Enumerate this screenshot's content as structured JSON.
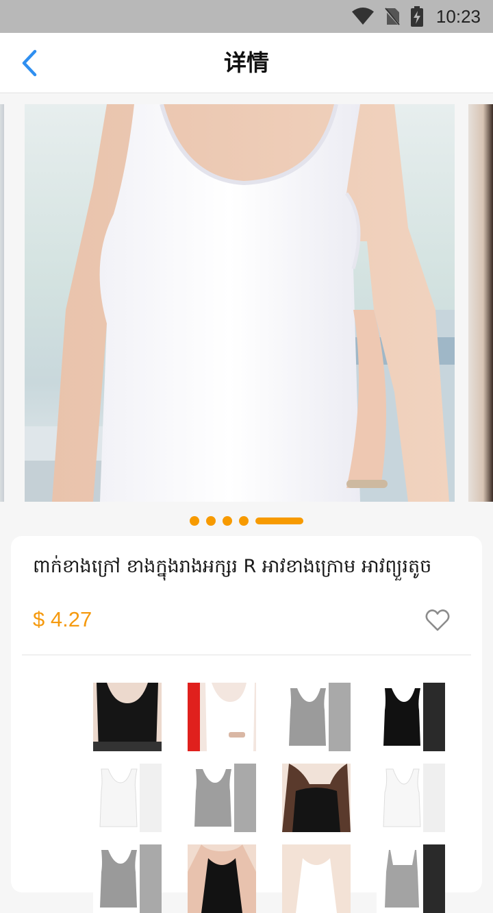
{
  "status_bar": {
    "time": "10:23",
    "icons": [
      "wifi-icon",
      "no-sim-icon",
      "battery-charging-icon"
    ]
  },
  "header": {
    "back_icon": "chevron-left-icon",
    "title": "详情"
  },
  "carousel": {
    "slide_count": 5,
    "active_index": 4
  },
  "product": {
    "title": "ពាក់ខាងក្រៅ ខាងក្នុងរាងអក្សរ R អាវខាងក្រោម អាវព្យួរតូច",
    "price": "$ 4.27",
    "favorite_icon": "heart-outline-icon"
  },
  "colors": {
    "accent": "#f79a00",
    "price": "#f59a0f",
    "back": "#2f8ff0"
  },
  "thumbnails": [
    {
      "name": "black-tank-model"
    },
    {
      "name": "white-tank-model-red-banner"
    },
    {
      "name": "gray-tank-flat"
    },
    {
      "name": "black-tank-flat"
    },
    {
      "name": "white-tank-flat"
    },
    {
      "name": "gray-tank-flat-2"
    },
    {
      "name": "black-tank-back-model"
    },
    {
      "name": "white-racerback-flat"
    },
    {
      "name": "gray-racerback-flat"
    },
    {
      "name": "black-tank-model-2"
    },
    {
      "name": "white-tank-model-2"
    },
    {
      "name": "gray-cami-flat"
    }
  ]
}
